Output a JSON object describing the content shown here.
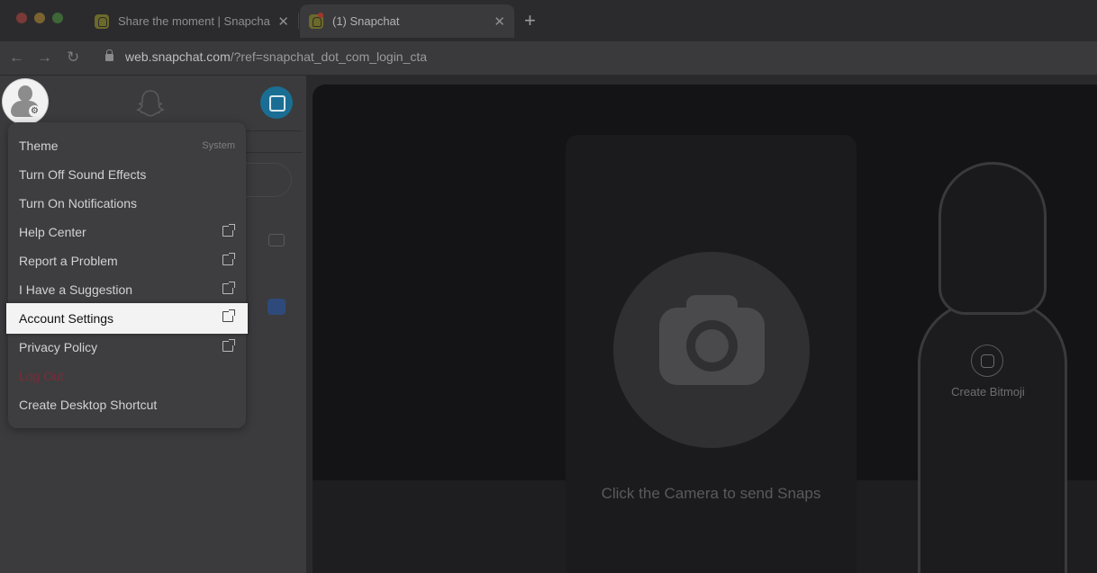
{
  "browser": {
    "tabs": [
      {
        "title": "Share the moment | Snapchat",
        "close": "✕"
      },
      {
        "title": "(1) Snapchat",
        "close": "✕"
      }
    ],
    "new_tab": "+",
    "nav": {
      "back": "←",
      "forward": "→",
      "reload": "↻"
    },
    "url": {
      "host": "web.snapchat.com",
      "path": "/?ref=snapchat_dot_com_login_cta"
    }
  },
  "menu": {
    "items": [
      {
        "label": "Theme",
        "sub": "System"
      },
      {
        "label": "Turn Off Sound Effects"
      },
      {
        "label": "Turn On Notifications"
      },
      {
        "label": "Help Center",
        "external": true
      },
      {
        "label": "Report a Problem",
        "external": true
      },
      {
        "label": "I Have a Suggestion",
        "external": true
      },
      {
        "label": "Account Settings",
        "external": true,
        "highlighted": true
      },
      {
        "label": "Privacy Policy",
        "external": true
      },
      {
        "label": "Log Out"
      },
      {
        "label": "Create Desktop Shortcut"
      }
    ]
  },
  "camera": {
    "hint": "Click the Camera to send Snaps"
  },
  "bitmoji": {
    "label": "Create Bitmoji"
  },
  "colors": {
    "logout": "#7a2b38",
    "accent": "#1a6e94",
    "highlight": "#f3f3f3"
  }
}
